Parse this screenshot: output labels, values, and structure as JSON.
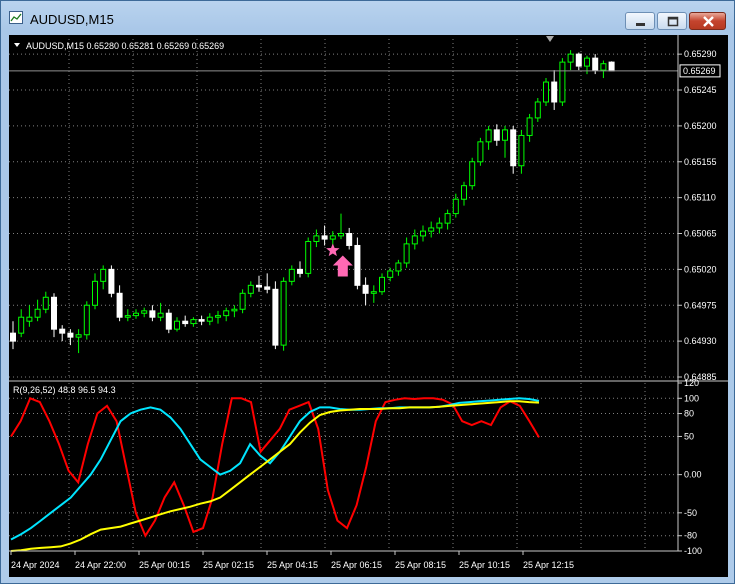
{
  "window": {
    "title": "AUDUSD,M15"
  },
  "colors": {
    "bull": "#00ff00",
    "bear": "#ffffff",
    "grid": "#808080",
    "text": "#ffffff",
    "star": "#ff69b4",
    "arrow": "#ff69b4",
    "line_red": "#ff0000",
    "line_cyan": "#00e5ff",
    "line_yellow": "#ffff00"
  },
  "main_chart": {
    "header": "AUDUSD,M15  0.65280 0.65281 0.65269 0.65269",
    "price_ticks": [
      "0.65290",
      "0.65245",
      "0.65200",
      "0.65155",
      "0.65110",
      "0.65065",
      "0.65020",
      "0.64975",
      "0.64930",
      "0.64885"
    ],
    "current_price": "0.65269"
  },
  "indicator": {
    "header": "R(9,26,52) 48.8 96.5 94.3",
    "ticks": [
      "120",
      "100",
      "80",
      "50",
      "0.00",
      "-50",
      "-80",
      "-100"
    ]
  },
  "time_axis": [
    "24 Apr 2024",
    "24 Apr 22:00",
    "25 Apr 00:15",
    "25 Apr 02:15",
    "25 Apr 04:15",
    "25 Apr 06:15",
    "25 Apr 08:15",
    "25 Apr 10:15",
    "25 Apr 12:15"
  ],
  "chart_data": [
    {
      "type": "candlestick",
      "title": "AUDUSD,M15",
      "ylim": [
        0.64885,
        0.65309
      ],
      "candles": [
        [
          0.6494,
          0.64955,
          0.6492,
          0.6493
        ],
        [
          0.6494,
          0.6497,
          0.64935,
          0.6496
        ],
        [
          0.64955,
          0.64975,
          0.64948,
          0.6496
        ],
        [
          0.6496,
          0.64982,
          0.64955,
          0.6497
        ],
        [
          0.6497,
          0.64992,
          0.64965,
          0.64985
        ],
        [
          0.64985,
          0.6499,
          0.64935,
          0.64945
        ],
        [
          0.64945,
          0.6495,
          0.6493,
          0.6494
        ],
        [
          0.6494,
          0.64945,
          0.64925,
          0.64935
        ],
        [
          0.64935,
          0.64945,
          0.64915,
          0.64938
        ],
        [
          0.64938,
          0.6498,
          0.64932,
          0.64975
        ],
        [
          0.64975,
          0.65015,
          0.6497,
          0.65005
        ],
        [
          0.65005,
          0.65025,
          0.64995,
          0.6502
        ],
        [
          0.6502,
          0.65025,
          0.64985,
          0.6499
        ],
        [
          0.6499,
          0.65,
          0.64955,
          0.6496
        ],
        [
          0.6496,
          0.6497,
          0.64955,
          0.64962
        ],
        [
          0.64962,
          0.6497,
          0.64958,
          0.64965
        ],
        [
          0.64965,
          0.64972,
          0.6496,
          0.64968
        ],
        [
          0.64968,
          0.64975,
          0.64955,
          0.6496
        ],
        [
          0.6496,
          0.64978,
          0.64955,
          0.64965
        ],
        [
          0.64965,
          0.6497,
          0.6494,
          0.64945
        ],
        [
          0.64945,
          0.6496,
          0.64942,
          0.64955
        ],
        [
          0.64955,
          0.64962,
          0.64948,
          0.64952
        ],
        [
          0.64952,
          0.6496,
          0.64948,
          0.64957
        ],
        [
          0.64957,
          0.64962,
          0.6495,
          0.64955
        ],
        [
          0.64955,
          0.64965,
          0.6495,
          0.6496
        ],
        [
          0.6496,
          0.64968,
          0.64952,
          0.64962
        ],
        [
          0.64962,
          0.64972,
          0.64955,
          0.64968
        ],
        [
          0.64968,
          0.64975,
          0.6496,
          0.6497
        ],
        [
          0.6497,
          0.64995,
          0.64965,
          0.6499
        ],
        [
          0.6499,
          0.65005,
          0.64985,
          0.65
        ],
        [
          0.65,
          0.65012,
          0.64992,
          0.64998
        ],
        [
          0.64998,
          0.65015,
          0.6499,
          0.64995
        ],
        [
          0.64995,
          0.65005,
          0.6492,
          0.64925
        ],
        [
          0.64925,
          0.6501,
          0.64918,
          0.65005
        ],
        [
          0.65005,
          0.65025,
          0.65,
          0.6502
        ],
        [
          0.6502,
          0.6503,
          0.6501,
          0.65015
        ],
        [
          0.65015,
          0.6506,
          0.6501,
          0.65055
        ],
        [
          0.65055,
          0.6507,
          0.65048,
          0.65062
        ],
        [
          0.65062,
          0.65075,
          0.6505,
          0.65058
        ],
        [
          0.65058,
          0.65068,
          0.6505,
          0.65062
        ],
        [
          0.65062,
          0.6509,
          0.65058,
          0.65065
        ],
        [
          0.65065,
          0.65072,
          0.65045,
          0.6505
        ],
        [
          0.6505,
          0.6506,
          0.64995,
          0.65
        ],
        [
          0.65,
          0.6501,
          0.64975,
          0.6499
        ],
        [
          0.6499,
          0.65,
          0.64978,
          0.64992
        ],
        [
          0.64992,
          0.65015,
          0.64988,
          0.6501
        ],
        [
          0.6501,
          0.65022,
          0.65005,
          0.65018
        ],
        [
          0.65018,
          0.65032,
          0.65012,
          0.65028
        ],
        [
          0.65028,
          0.6506,
          0.65022,
          0.65052
        ],
        [
          0.65052,
          0.6507,
          0.65045,
          0.65062
        ],
        [
          0.65062,
          0.65075,
          0.65055,
          0.65068
        ],
        [
          0.65068,
          0.6508,
          0.6506,
          0.65072
        ],
        [
          0.65072,
          0.65085,
          0.65065,
          0.65078
        ],
        [
          0.65078,
          0.65095,
          0.6507,
          0.6509
        ],
        [
          0.6509,
          0.65115,
          0.65085,
          0.65108
        ],
        [
          0.65108,
          0.6513,
          0.651,
          0.65125
        ],
        [
          0.65125,
          0.6516,
          0.6512,
          0.65155
        ],
        [
          0.65155,
          0.65185,
          0.6515,
          0.6518
        ],
        [
          0.6518,
          0.652,
          0.6517,
          0.65195
        ],
        [
          0.65195,
          0.65202,
          0.65175,
          0.65182
        ],
        [
          0.65182,
          0.652,
          0.6516,
          0.65195
        ],
        [
          0.65195,
          0.652,
          0.6514,
          0.6515
        ],
        [
          0.6515,
          0.65195,
          0.6514,
          0.65188
        ],
        [
          0.65188,
          0.65215,
          0.6518,
          0.6521
        ],
        [
          0.6521,
          0.65235,
          0.65205,
          0.6523
        ],
        [
          0.6523,
          0.6526,
          0.65225,
          0.65255
        ],
        [
          0.65255,
          0.6527,
          0.6522,
          0.6523
        ],
        [
          0.6523,
          0.65285,
          0.65225,
          0.6528
        ],
        [
          0.6528,
          0.65295,
          0.6527,
          0.6529
        ],
        [
          0.6529,
          0.65292,
          0.6527,
          0.65275
        ],
        [
          0.65275,
          0.65288,
          0.65265,
          0.65285
        ],
        [
          0.65285,
          0.6529,
          0.65265,
          0.6527
        ],
        [
          0.6527,
          0.65282,
          0.6526,
          0.65278
        ],
        [
          0.6528,
          0.65281,
          0.65269,
          0.65269
        ]
      ]
    },
    {
      "type": "line",
      "title": "R(9,26,52)",
      "ylim": [
        -100,
        120
      ],
      "series": [
        {
          "color": "#ff0000",
          "values": [
            50,
            70,
            100,
            95,
            70,
            40,
            5,
            -10,
            40,
            80,
            90,
            70,
            10,
            -50,
            -80,
            -60,
            -30,
            -10,
            -40,
            -75,
            -70,
            -30,
            40,
            100,
            100,
            95,
            30,
            45,
            60,
            85,
            90,
            95,
            60,
            -20,
            -60,
            -70,
            -40,
            10,
            70,
            95,
            98,
            100,
            99,
            100,
            100,
            98,
            92,
            70,
            65,
            70,
            65,
            88,
            96,
            90,
            70,
            48.8
          ]
        },
        {
          "color": "#00e5ff",
          "values": [
            -85,
            -78,
            -70,
            -60,
            -50,
            -40,
            -30,
            -15,
            0,
            20,
            45,
            70,
            80,
            85,
            88,
            85,
            75,
            60,
            40,
            20,
            10,
            0,
            5,
            15,
            40,
            25,
            15,
            30,
            50,
            70,
            82,
            88,
            88,
            86,
            85,
            85,
            86,
            87,
            87,
            88,
            88,
            88,
            88,
            89,
            91,
            94,
            95,
            96,
            97,
            98,
            99,
            100,
            99,
            96.5
          ]
        },
        {
          "color": "#ffff00",
          "values": [
            -100,
            -99,
            -97,
            -96,
            -95,
            -94,
            -90,
            -85,
            -78,
            -72,
            -70,
            -68,
            -64,
            -60,
            -56,
            -52,
            -48,
            -45,
            -42,
            -38,
            -35,
            -30,
            -20,
            -10,
            0,
            10,
            20,
            30,
            40,
            55,
            68,
            78,
            82,
            84,
            85,
            86,
            86,
            86,
            87,
            87,
            88,
            88,
            88,
            89,
            90,
            91,
            92,
            93,
            94,
            95,
            96,
            96,
            95,
            94.3
          ]
        }
      ]
    }
  ]
}
